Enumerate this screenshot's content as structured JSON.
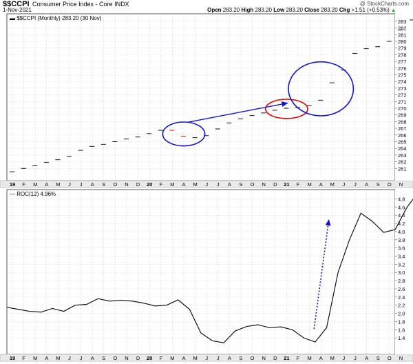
{
  "header": {
    "symbol": "$$CCPI",
    "description": "Consumer Price Index - Core",
    "exchange": "INDX",
    "date": "1-Nov-2021",
    "watermark": "@ StockCharts.com",
    "ohlc": {
      "open_label": "Open",
      "open": "283.20",
      "high_label": "High",
      "high": "283.20",
      "low_label": "Low",
      "low": "283.20",
      "close_label": "Close",
      "close": "283.20",
      "chg_label": "Chg",
      "chg": "+1.51 (+0.53%)",
      "chg_arrow": "▲"
    }
  },
  "chart_data": [
    {
      "type": "ohlc",
      "legend": "$$CCPI (Monthly) 283.20 (30 Nov)",
      "x": [
        "19",
        "F",
        "M",
        "A",
        "M",
        "J",
        "J",
        "A",
        "S",
        "O",
        "N",
        "D",
        "20",
        "F",
        "M",
        "A",
        "M",
        "J",
        "J",
        "A",
        "S",
        "O",
        "N",
        "D",
        "21",
        "F",
        "M",
        "A",
        "M",
        "J",
        "J",
        "A",
        "S",
        "O",
        "N"
      ],
      "values": [
        260.5,
        261.0,
        261.4,
        261.9,
        262.3,
        262.8,
        263.7,
        264.3,
        264.6,
        265.0,
        265.4,
        265.7,
        266.2,
        266.7,
        266.7,
        265.8,
        265.6,
        265.9,
        266.9,
        267.8,
        268.4,
        268.9,
        269.3,
        269.7,
        270.0,
        270.1,
        270.4,
        271.2,
        273.8,
        275.7,
        278.2,
        278.9,
        279.2,
        280.0,
        281.7,
        283.2
      ],
      "ylim": [
        260,
        283.5
      ],
      "yticks": [
        261,
        262,
        263,
        264,
        265,
        266,
        267,
        268,
        269,
        270,
        271,
        272,
        273,
        274,
        275,
        276,
        277,
        278,
        279,
        280,
        281,
        282,
        283
      ],
      "red_months": [
        14,
        15
      ],
      "annotations": {
        "ellipses": [
          {
            "color": "#1212c8",
            "around_months": [
              14,
              16
            ]
          },
          {
            "color": "#dd0000",
            "around_months": [
              23,
              25
            ]
          },
          {
            "color": "#1212c8",
            "around_months": [
              25,
              29
            ]
          }
        ],
        "arrow": {
          "color": "#1212c8",
          "from_month": 15,
          "to_month": 24,
          "style": "solid"
        }
      }
    },
    {
      "type": "line",
      "legend": "ROC(12) 4.96%",
      "x": [
        "19",
        "F",
        "M",
        "A",
        "M",
        "J",
        "J",
        "A",
        "S",
        "O",
        "N",
        "D",
        "20",
        "F",
        "M",
        "A",
        "M",
        "J",
        "J",
        "A",
        "S",
        "O",
        "N",
        "D",
        "21",
        "F",
        "M",
        "A",
        "M",
        "J",
        "J",
        "A",
        "S",
        "O",
        "N"
      ],
      "values": [
        2.15,
        2.1,
        2.05,
        2.03,
        2.12,
        2.05,
        2.2,
        2.22,
        2.36,
        2.3,
        2.32,
        2.3,
        2.25,
        2.18,
        2.2,
        2.33,
        2.1,
        1.52,
        1.33,
        1.28,
        1.57,
        1.68,
        1.72,
        1.65,
        1.67,
        1.6,
        1.4,
        1.3,
        1.65,
        3.0,
        3.8,
        4.45,
        4.25,
        3.98,
        4.05,
        4.58,
        4.96
      ],
      "ylim": [
        1.2,
        4.96
      ],
      "yticks": [
        1.4,
        1.6,
        1.8,
        2.0,
        2.2,
        2.4,
        2.6,
        2.8,
        3.0,
        3.2,
        3.4,
        3.6,
        3.8,
        4.0,
        4.2,
        4.4,
        4.6,
        4.8
      ],
      "annotations": {
        "arrow": {
          "color": "#1212c8",
          "from": [
            26.9,
            1.62
          ],
          "to": [
            28.2,
            4.3
          ],
          "style": "dotted"
        }
      }
    }
  ]
}
